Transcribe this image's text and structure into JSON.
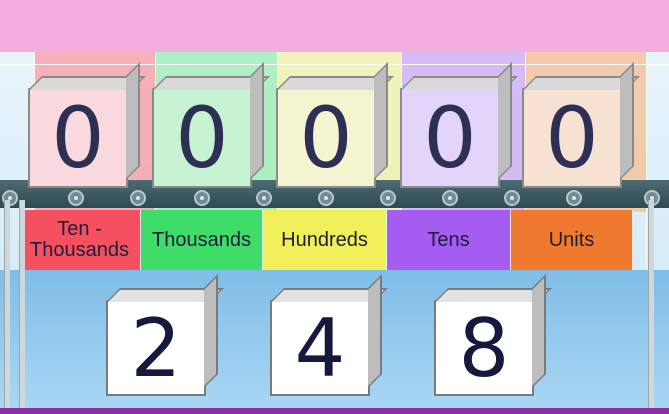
{
  "columns": [
    {
      "label": "Ten -\nThousands",
      "digit": "0",
      "color": "#f5505f"
    },
    {
      "label": "Thousands",
      "digit": "0",
      "color": "#3fdc6a"
    },
    {
      "label": "Hundreds",
      "digit": "0",
      "color": "#f0ef5a"
    },
    {
      "label": "Tens",
      "digit": "0",
      "color": "#a45cf1"
    },
    {
      "label": "Units",
      "digit": "0",
      "color": "#ef7a2f"
    }
  ],
  "tiles": [
    "2",
    "4",
    "8"
  ]
}
